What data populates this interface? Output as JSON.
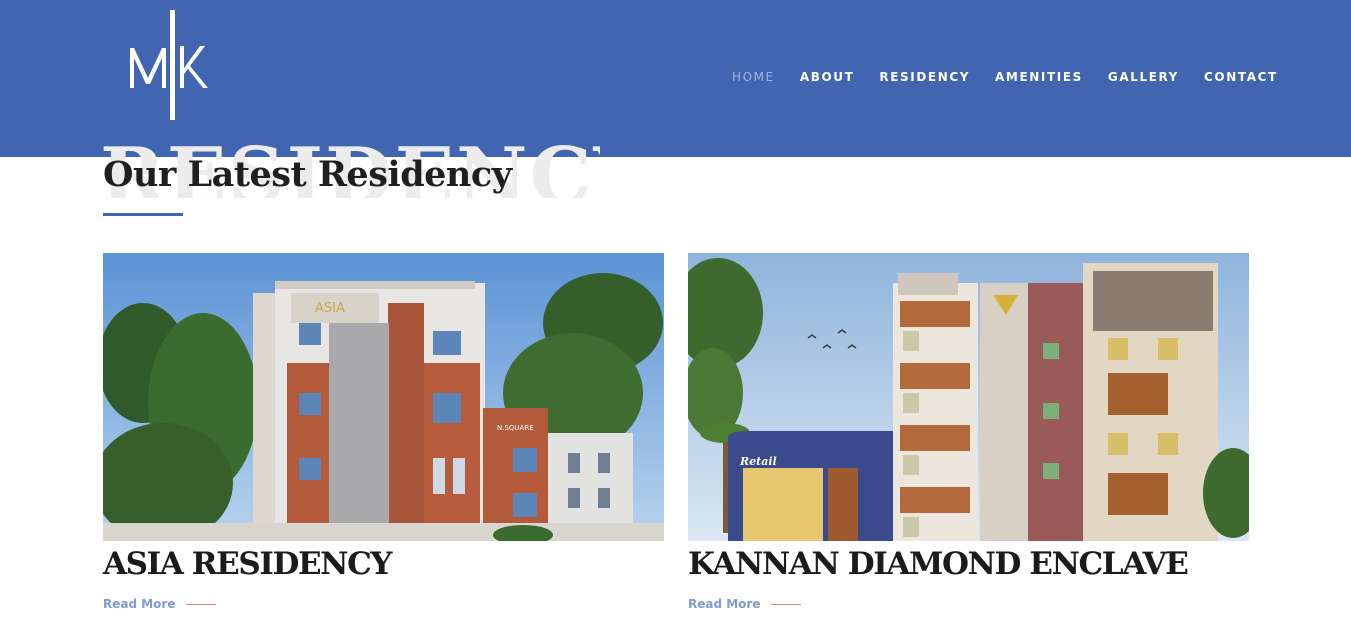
{
  "brand": {
    "logo_text": "MK"
  },
  "nav": {
    "items": [
      {
        "label": "HOME",
        "active": true
      },
      {
        "label": "ABOUT",
        "active": false
      },
      {
        "label": "RESIDENCY",
        "active": false
      },
      {
        "label": "AMENITIES",
        "active": false
      },
      {
        "label": "GALLERY",
        "active": false
      },
      {
        "label": "CONTACT",
        "active": false
      }
    ]
  },
  "section": {
    "background_word": "RESIDENCY",
    "title": "Our Latest Residency"
  },
  "cards": [
    {
      "title": "ASIA RESIDENCY",
      "read_more": "Read More",
      "image_signs": {
        "name": "ASIA",
        "secondary": "N.SQUARE"
      }
    },
    {
      "title": "KANNAN DIAMOND ENCLAVE",
      "read_more": "Read More",
      "image_signs": {
        "shop": "Retail"
      }
    }
  ],
  "colors": {
    "header_bg": "#4165b0",
    "nav_active": "#9db4e0",
    "accent": "#4165b0",
    "read_more": "#7f9bd0"
  }
}
